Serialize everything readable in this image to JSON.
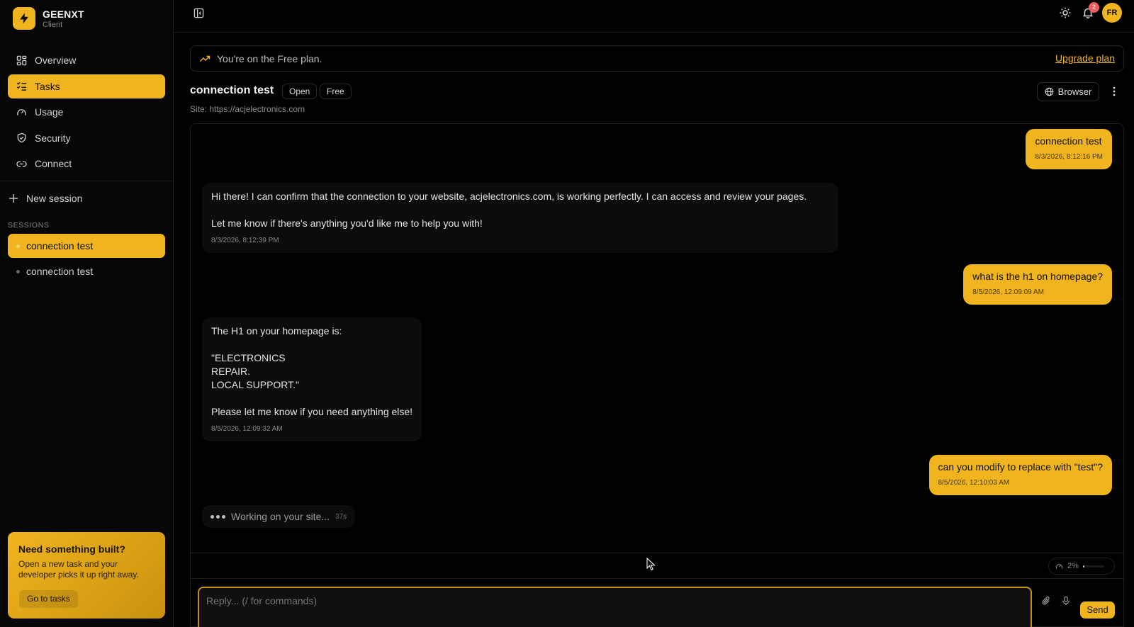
{
  "brand": {
    "name": "GEENXT",
    "subtitle": "Client"
  },
  "sidebar": {
    "nav": [
      {
        "label": "Overview",
        "icon": "grid-icon",
        "active": false
      },
      {
        "label": "Tasks",
        "icon": "list-check-icon",
        "active": true
      },
      {
        "label": "Usage",
        "icon": "gauge-icon",
        "active": false
      },
      {
        "label": "Security",
        "icon": "shield-icon",
        "active": false
      },
      {
        "label": "Connect",
        "icon": "link-icon",
        "active": false
      }
    ],
    "new_session": "New session",
    "sessions_label": "SESSIONS",
    "sessions": [
      {
        "label": "connection test",
        "active": true
      },
      {
        "label": "connection test",
        "active": false
      }
    ],
    "promo": {
      "title": "Need something built?",
      "text": "Open a new task and your developer picks it up right away.",
      "button": "Go to tasks"
    }
  },
  "topbar": {
    "notification_count": "2",
    "avatar_initials": "FR"
  },
  "plan": {
    "text": "You're on the Free plan.",
    "upgrade": "Upgrade plan"
  },
  "task": {
    "title": "connection test",
    "status": "Open",
    "tier": "Free",
    "site": "Site: https://acjelectronics.com",
    "browser_button": "Browser"
  },
  "messages": [
    {
      "role": "user",
      "text": "connection test",
      "time": "8/3/2026, 8:12:16 PM"
    },
    {
      "role": "assistant",
      "text": "Hi there! I can confirm that the connection to your website, acjelectronics.com, is working perfectly. I can access and review your pages.\n\nLet me know if there's anything you'd like me to help you with!",
      "time": "8/3/2026, 8:12:39 PM"
    },
    {
      "role": "user",
      "text": "what is the h1 on homepage?",
      "time": "8/5/2026, 12:09:09 AM"
    },
    {
      "role": "assistant",
      "text": "The H1 on your homepage is:\n\n\"ELECTRONICS\nREPAIR.\nLOCAL SUPPORT.\"\n\nPlease let me know if you need anything else!",
      "time": "8/5/2026, 12:09:32 AM"
    },
    {
      "role": "user",
      "text": "can you modify to replace with \"test\"?",
      "time": "8/5/2026, 12:10:03 AM"
    }
  ],
  "working": {
    "text": "Working on your site...",
    "elapsed": "37s"
  },
  "usage": {
    "label": "2%",
    "fraction": 0.02
  },
  "composer": {
    "placeholder": "Reply... (/ for commands)",
    "send": "Send"
  },
  "colors": {
    "accent": "#f0b41e",
    "background": "#000000",
    "badge": "#ef5b5b"
  }
}
